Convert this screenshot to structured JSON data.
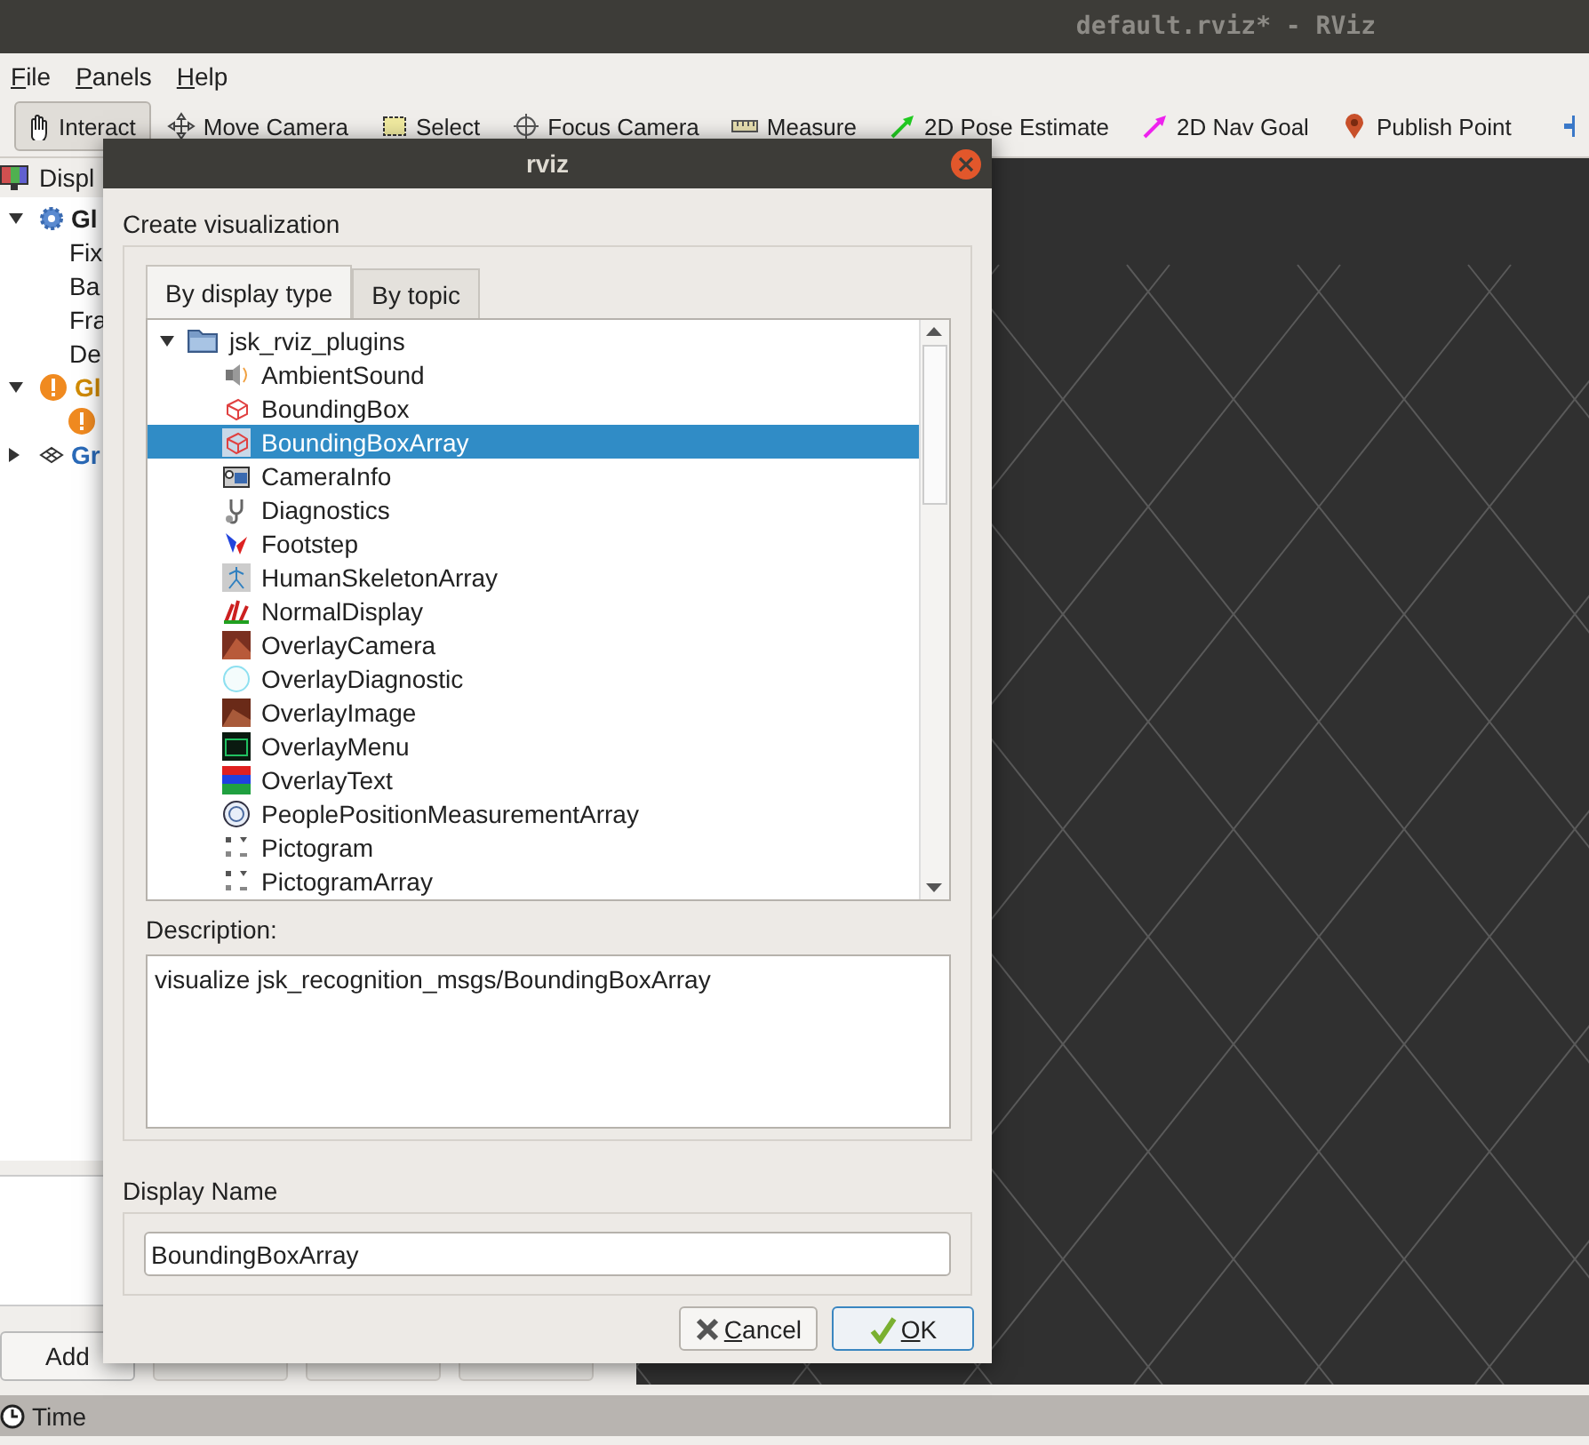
{
  "window": {
    "title": "default.rviz* - RViz"
  },
  "menu": [
    {
      "label": "File"
    },
    {
      "label": "Panels"
    },
    {
      "label": "Help"
    }
  ],
  "toolbar": [
    {
      "label": "Interact",
      "selected": true
    },
    {
      "label": "Move Camera",
      "selected": false
    },
    {
      "label": "Select",
      "selected": false
    },
    {
      "label": "Focus Camera",
      "selected": false
    },
    {
      "label": "Measure",
      "selected": false
    },
    {
      "label": "2D Pose Estimate",
      "selected": false
    },
    {
      "label": "2D Nav Goal",
      "selected": false
    },
    {
      "label": "Publish Point",
      "selected": false
    }
  ],
  "displays_panel": {
    "title": "Displ",
    "items": [
      {
        "kind": "settings",
        "label": "Gl",
        "expanded": true,
        "children": [
          {
            "label": "Fix"
          },
          {
            "label": "Ba"
          },
          {
            "label": "Fra"
          },
          {
            "label": "De"
          }
        ]
      },
      {
        "kind": "warning",
        "label": "Gl",
        "expanded": true,
        "children": [
          {
            "kind": "warning"
          }
        ]
      },
      {
        "kind": "grid",
        "label": "Gr",
        "expanded": false
      }
    ],
    "buttons": [
      {
        "label": "Add",
        "disabled": false
      },
      {
        "disabled": true
      },
      {
        "disabled": true
      },
      {
        "disabled": true
      }
    ]
  },
  "time_panel": {
    "title": "Time"
  },
  "dialog": {
    "title": "rviz",
    "heading": "Create visualization",
    "tabs": [
      {
        "label": "By display type",
        "selected": true
      },
      {
        "label": "By topic",
        "selected": false
      }
    ],
    "tree": {
      "label": "jsk_rviz_plugins",
      "expanded": true,
      "children": [
        {
          "label": "AmbientSound",
          "selected": false
        },
        {
          "label": "BoundingBox",
          "selected": false
        },
        {
          "label": "BoundingBoxArray",
          "selected": true
        },
        {
          "label": "CameraInfo",
          "selected": false
        },
        {
          "label": "Diagnostics",
          "selected": false
        },
        {
          "label": "Footstep",
          "selected": false
        },
        {
          "label": "HumanSkeletonArray",
          "selected": false
        },
        {
          "label": "NormalDisplay",
          "selected": false
        },
        {
          "label": "OverlayCamera",
          "selected": false
        },
        {
          "label": "OverlayDiagnostic",
          "selected": false
        },
        {
          "label": "OverlayImage",
          "selected": false
        },
        {
          "label": "OverlayMenu",
          "selected": false
        },
        {
          "label": "OverlayText",
          "selected": false
        },
        {
          "label": "PeoplePositionMeasurementArray",
          "selected": false
        },
        {
          "label": "Pictogram",
          "selected": false
        },
        {
          "label": "PictogramArray",
          "selected": false
        }
      ]
    },
    "description_label": "Description:",
    "description": "visualize jsk_recognition_msgs/BoundingBoxArray",
    "name_label": "Display Name",
    "name_value": "BoundingBoxArray",
    "buttons": [
      {
        "label": "Cancel",
        "kind": "cancel"
      },
      {
        "label": "OK",
        "kind": "ok"
      }
    ]
  }
}
